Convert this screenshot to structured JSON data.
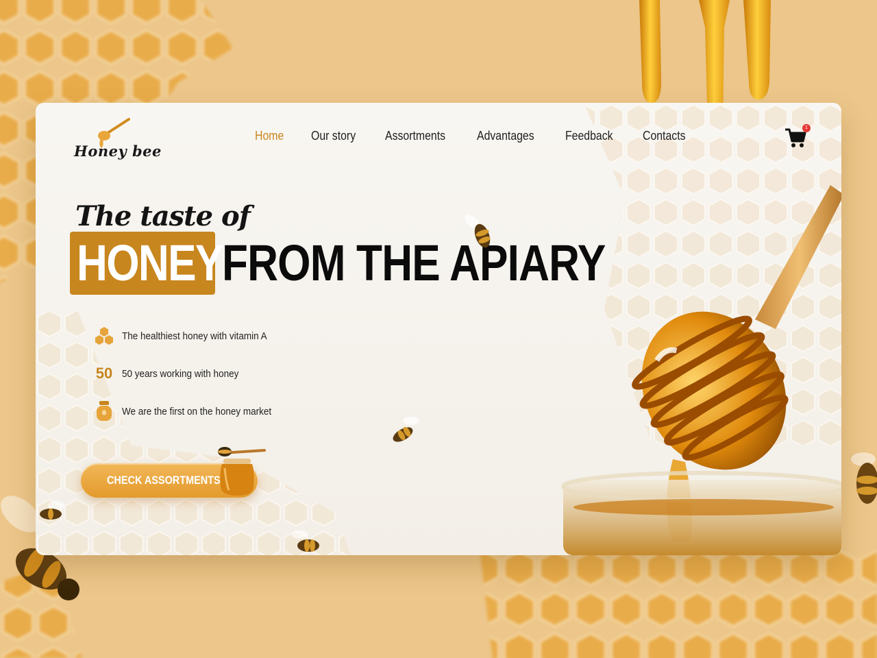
{
  "brand": {
    "name": "Honey bee"
  },
  "nav": {
    "items": [
      {
        "label": "Home",
        "active": true
      },
      {
        "label": "Our story",
        "active": false
      },
      {
        "label": "Assortments",
        "active": false
      },
      {
        "label": "Advantages",
        "active": false
      },
      {
        "label": "Feedback",
        "active": false
      },
      {
        "label": "Contacts",
        "active": false
      }
    ]
  },
  "cart": {
    "count": "1",
    "icon": "cart-icon"
  },
  "hero": {
    "tagline": "The taste of",
    "highlight": "HONEY",
    "headline_rest": "FROM THE APIARY"
  },
  "features": [
    {
      "icon": "honeycomb-icon",
      "text": "The healthiest honey with vitamin A"
    },
    {
      "icon": "fifty-number",
      "number": "50",
      "text": "50 years working with honey"
    },
    {
      "icon": "honey-jar-icon",
      "text": "We are the first on the honey market"
    }
  ],
  "cta": {
    "label": "CHECK ASSORTMENTS"
  },
  "colors": {
    "accent": "#c8861e",
    "background": "#ecc68a",
    "card": "#f6f3ee",
    "text": "#111111"
  }
}
